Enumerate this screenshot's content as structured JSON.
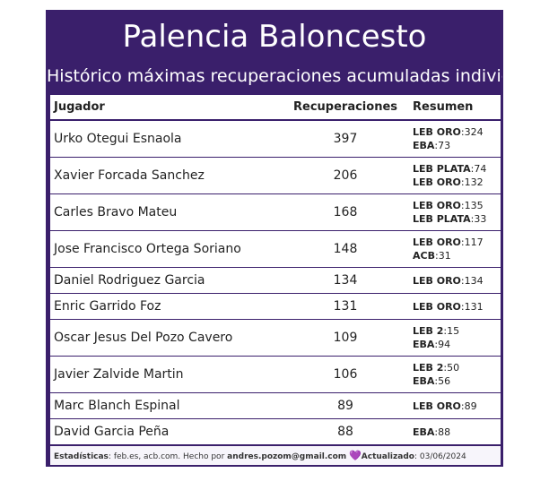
{
  "title": "Palencia Baloncesto",
  "subtitle": "Histórico máximas recuperaciones acumuladas individual",
  "columns": {
    "player": "Jugador",
    "value": "Recuperaciones",
    "summary": "Resumen"
  },
  "rows": [
    {
      "player": "Urko Otegui Esnaola",
      "value": "397",
      "summary": [
        [
          "LEB ORO",
          "324"
        ],
        [
          "EBA",
          "73"
        ]
      ]
    },
    {
      "player": "Xavier Forcada Sanchez",
      "value": "206",
      "summary": [
        [
          "LEB PLATA",
          "74"
        ],
        [
          "LEB ORO",
          "132"
        ]
      ]
    },
    {
      "player": "Carles Bravo Mateu",
      "value": "168",
      "summary": [
        [
          "LEB ORO",
          "135"
        ],
        [
          "LEB PLATA",
          "33"
        ]
      ]
    },
    {
      "player": "Jose Francisco Ortega Soriano",
      "value": "148",
      "summary": [
        [
          "LEB ORO",
          "117"
        ],
        [
          "ACB",
          "31"
        ]
      ]
    },
    {
      "player": "Daniel Rodriguez Garcia",
      "value": "134",
      "summary": [
        [
          "LEB ORO",
          "134"
        ]
      ]
    },
    {
      "player": "Enric Garrido Foz",
      "value": "131",
      "summary": [
        [
          "LEB ORO",
          "131"
        ]
      ]
    },
    {
      "player": "Oscar Jesus Del Pozo Cavero",
      "value": "109",
      "summary": [
        [
          "LEB 2",
          "15"
        ],
        [
          "EBA",
          "94"
        ]
      ]
    },
    {
      "player": "Javier Zalvide Martin",
      "value": "106",
      "summary": [
        [
          "LEB 2",
          "50"
        ],
        [
          "EBA",
          "56"
        ]
      ]
    },
    {
      "player": "Marc Blanch Espinal",
      "value": "89",
      "summary": [
        [
          "LEB ORO",
          "89"
        ]
      ]
    },
    {
      "player": "David Garcia Peña",
      "value": "88",
      "summary": [
        [
          "EBA",
          "88"
        ]
      ]
    }
  ],
  "footer": {
    "stats_label": "Estadísticas",
    "stats_text": ": feb.es, acb.com. Hecho por ",
    "author": "andres.pozom@gmail.com",
    "heart": "💜",
    "updated_label": "Actualizado",
    "updated_text": ": 03/06/2024"
  }
}
